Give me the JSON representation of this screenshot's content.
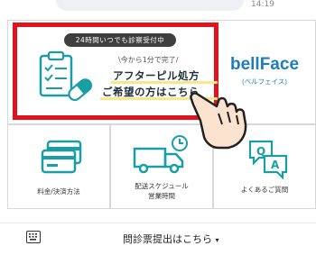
{
  "status": {
    "time": "14:19",
    "back_glyph": "‹"
  },
  "promo": {
    "badge": "24時間いつでも診察受付中",
    "subtitle": "\\今から1分で完了/",
    "line1": "アフターピル処方",
    "line2": "ご希望の方はこちら",
    "icon": "clipboard-pill-icon"
  },
  "bellface": {
    "logo": "bellFace",
    "kana": "(ベルフェイス)"
  },
  "tiles": [
    {
      "label": "料金/決済方法",
      "icon": "credit-card-icon"
    },
    {
      "label1": "配送スケジュール",
      "label2": "営業時間",
      "icon": "delivery-truck-icon"
    },
    {
      "label": "よくあるご質問",
      "icon": "qa-chat-icon"
    }
  ],
  "footer": {
    "label": "問診票提出はこちら",
    "chevron": "▾",
    "icon": "keyboard-icon"
  },
  "colors": {
    "frame_red": "#e1141e",
    "teal": "#1a9ea6",
    "brand_blue": "#1f7db8"
  }
}
